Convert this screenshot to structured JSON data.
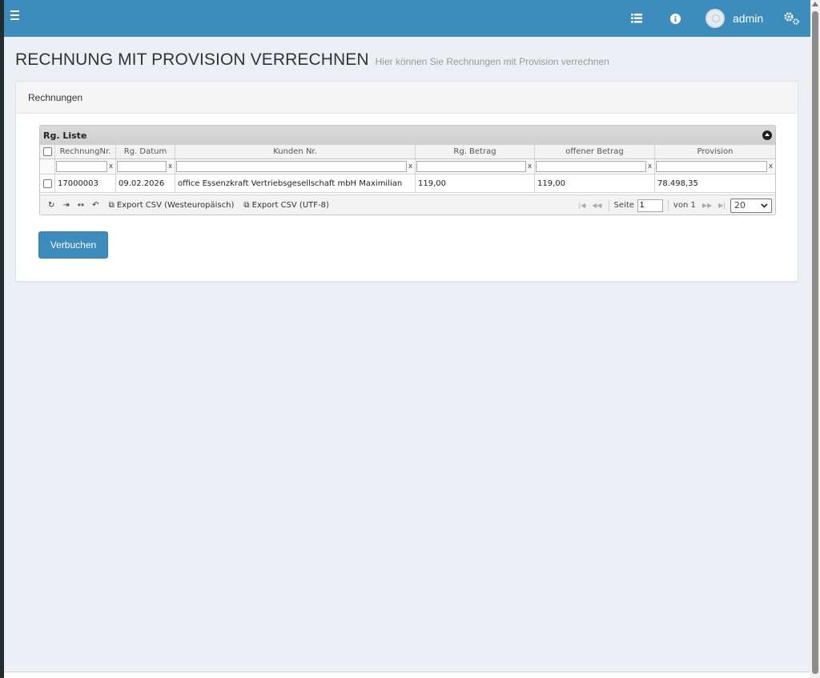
{
  "navbar": {
    "user_name": "admin",
    "icons": [
      "menu-icon",
      "list-icon",
      "info-icon",
      "gears-icon"
    ]
  },
  "page": {
    "title": "RECHNUNG MIT PROVISION VERRECHNEN",
    "subtitle": "Hier können Sie Rechnungen mit Provision verrechnen"
  },
  "box": {
    "header": "Rechnungen"
  },
  "grid": {
    "caption": "Rg. Liste",
    "columns": [
      "RechnungNr.",
      "Rg. Datum",
      "Kunden Nr.",
      "Rg. Betrag",
      "offener Betrag",
      "Provision"
    ],
    "filter_clear": "x",
    "rows": [
      {
        "rechnung_nr": "17000003",
        "rg_datum": "09.02.2026",
        "kunden_nr": "office Essenzkraft Vertriebsgesellschaft mbH Maximilian",
        "rg_betrag": "119,00",
        "offener_betrag": "119,00",
        "provision": "78.498,35"
      }
    ],
    "pager": {
      "export_west": "Export CSV (Westeuropäisch)",
      "export_utf8": "Export CSV (UTF-8)",
      "page_label": "Seite",
      "page_value": "1",
      "of_label": "von 1",
      "rows_per_page": "20"
    }
  },
  "actions": {
    "book_label": "Verbuchen"
  },
  "colors": {
    "primary": "#3c8dbc",
    "sidebar": "#222d32",
    "background": "#ecf0f5"
  }
}
